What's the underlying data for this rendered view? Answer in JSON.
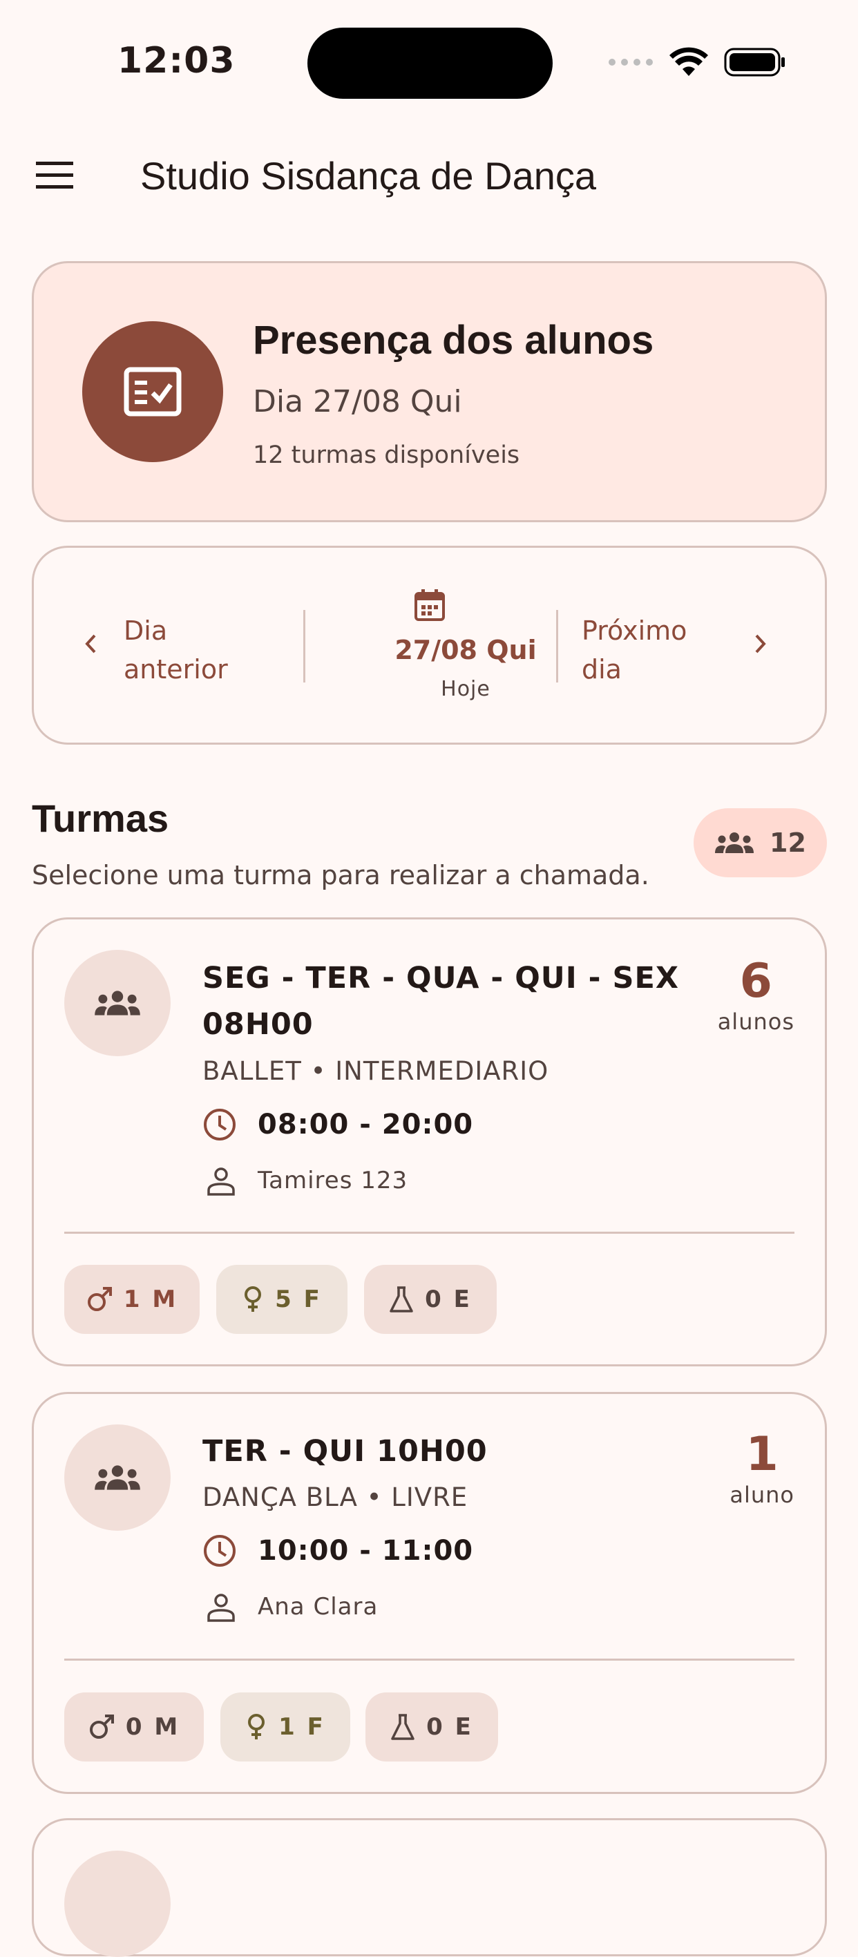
{
  "status_bar": {
    "time": "12:03"
  },
  "app_bar": {
    "title": "Studio Sisdança de Dança",
    "menu_icon": "menu-icon"
  },
  "hero": {
    "title": "Presença dos alunos",
    "date": "Dia 27/08 Qui",
    "subtitle": "12 turmas disponíveis",
    "icon": "checklist-icon"
  },
  "day_nav": {
    "prev_line1": "Dia",
    "prev_line2": "anterior",
    "current_date": "27/08 Qui",
    "current_label": "Hoje",
    "next_line1": "Próximo",
    "next_line2": "dia"
  },
  "section": {
    "title": "Turmas",
    "subtitle": "Selecione uma turma para realizar a chamada.",
    "count": "12"
  },
  "turmas": [
    {
      "title": "SEG - TER - QUA - QUI - SEX 08H00",
      "style": "BALLET • INTERMEDIARIO",
      "time": "08:00 - 20:00",
      "teacher": "Tamires 123",
      "count": "6",
      "count_label": "alunos",
      "chip_m": "1 M",
      "chip_f": "5 F",
      "chip_e": "0 E"
    },
    {
      "title": "TER - QUI 10H00",
      "style": "DANÇA BLA • LIVRE",
      "time": "10:00 - 11:00",
      "teacher": "Ana Clara",
      "count": "1",
      "count_label": "aluno",
      "chip_m": "0 M",
      "chip_f": "1 F",
      "chip_e": "0 E"
    }
  ],
  "colors": {
    "primary": "#8C4A3A",
    "background": "#FFF8F6",
    "hero_bg": "#FFE9E3",
    "outline": "#D8C2BC"
  }
}
